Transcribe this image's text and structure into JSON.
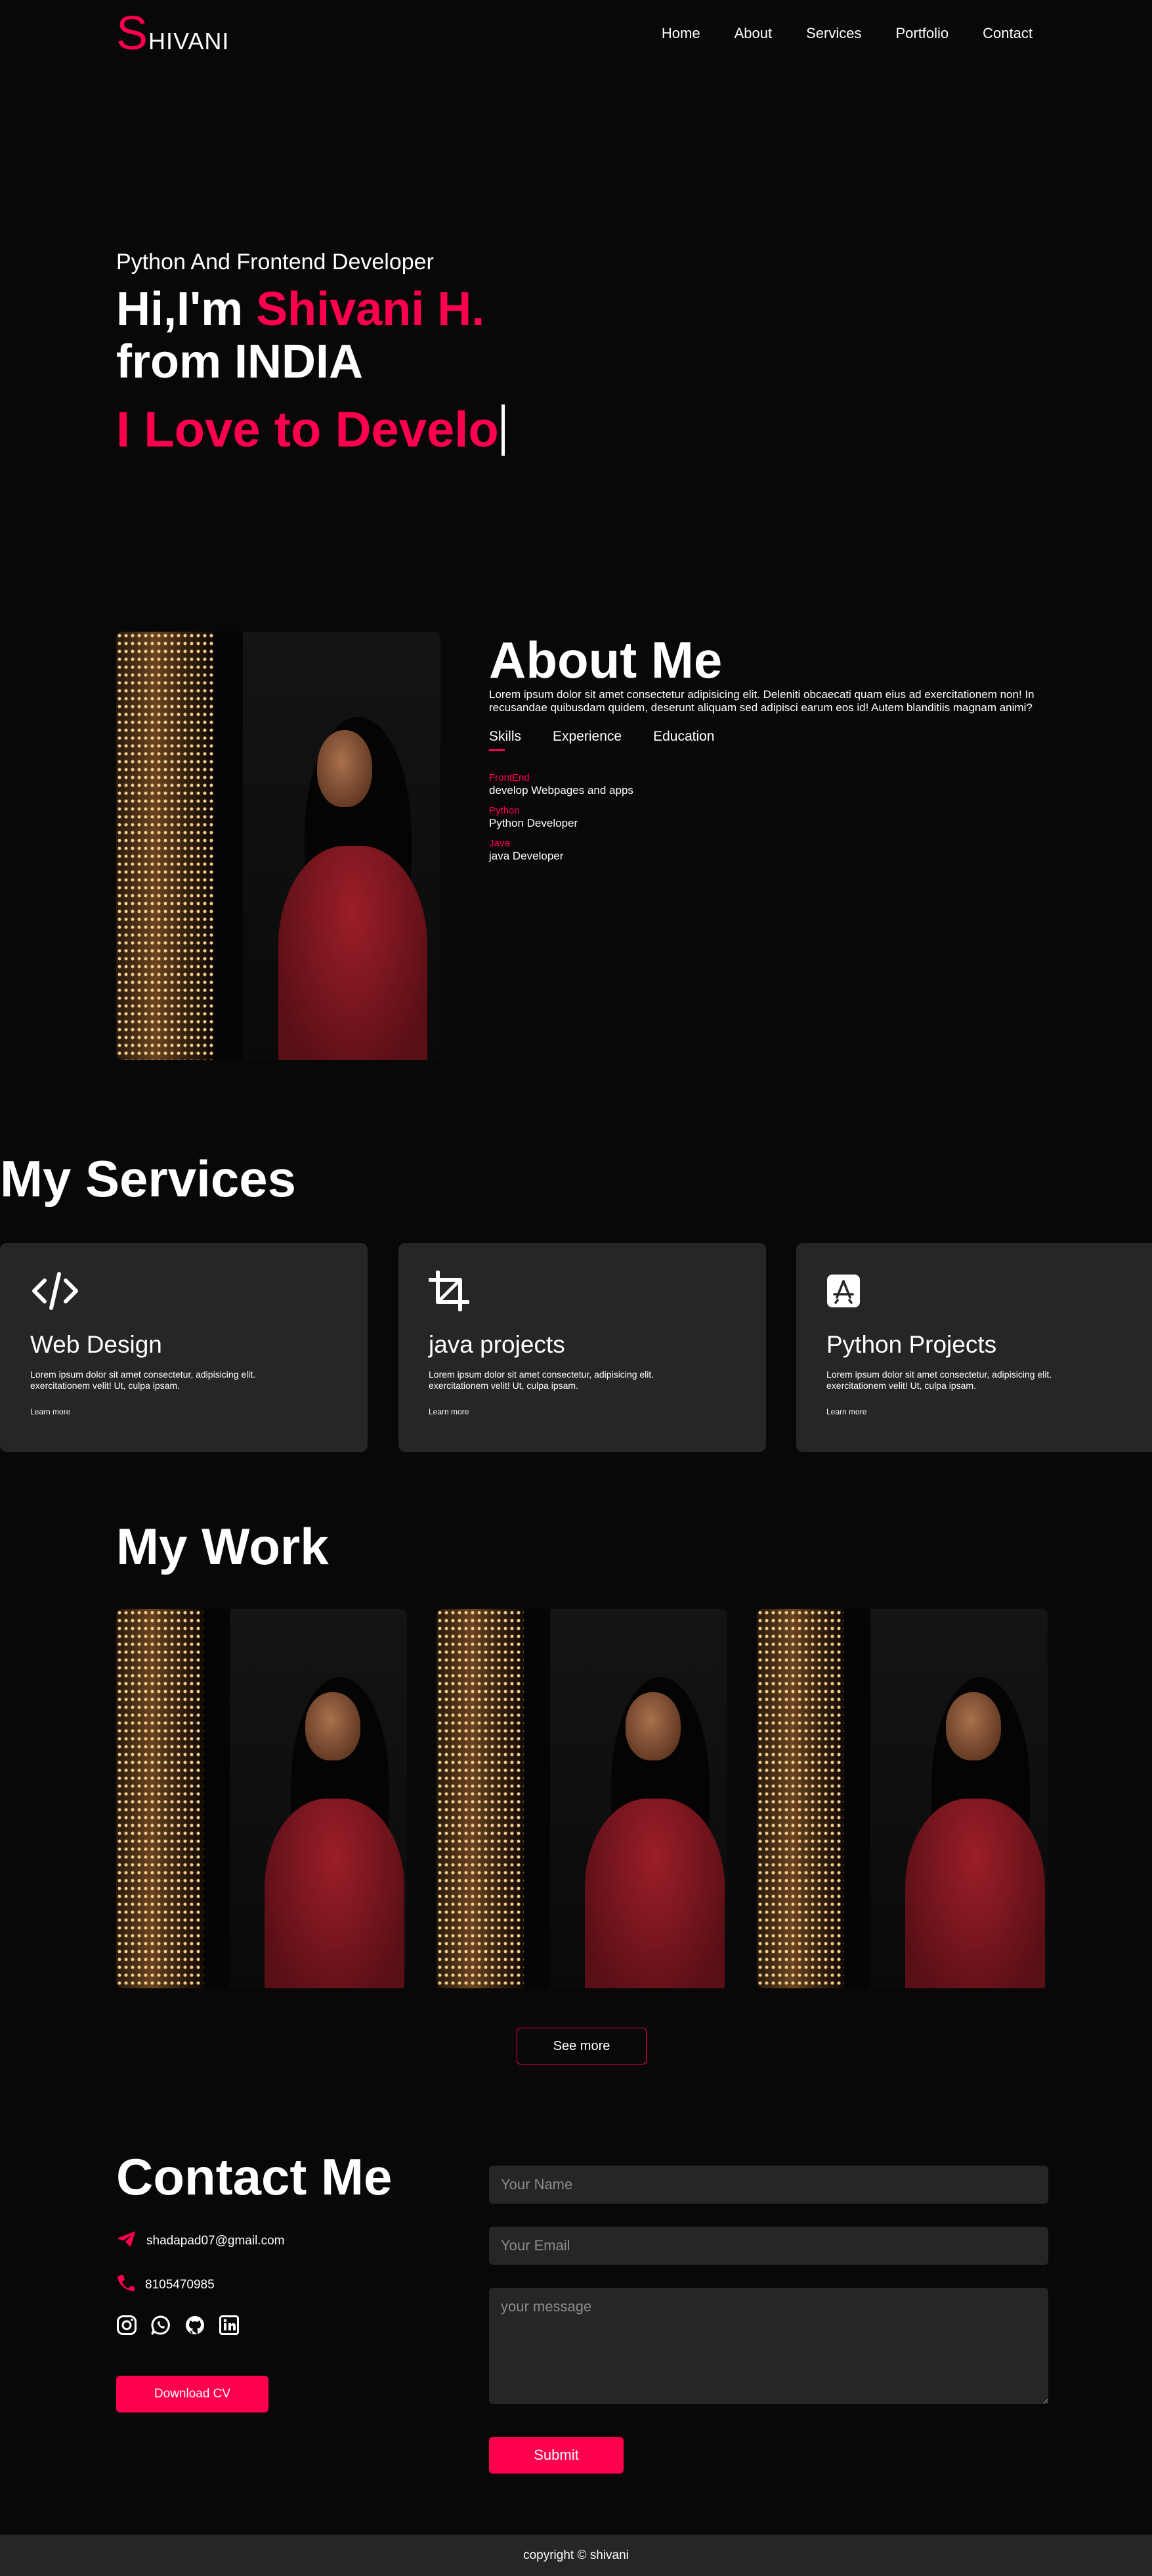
{
  "nav": {
    "logo_initial": "S",
    "logo_rest": "HIVANI",
    "links": [
      "Home",
      "About",
      "Services",
      "Portfolio",
      "Contact"
    ]
  },
  "hero": {
    "subtitle": "Python And Frontend Developer",
    "greeting": "Hi,I'm ",
    "name": "Shivani H.",
    "from": "from INDIA",
    "typing": "I Love to Develo"
  },
  "about": {
    "title": "About Me",
    "text": "Lorem ipsum dolor sit amet consectetur adipisicing elit. Deleniti obcaecati quam eius ad exercitationem non! In recusandae quibusdam quidem, deserunt aliquam sed adipisci earum eos id! Autem blanditiis magnam animi?",
    "tabs": [
      "Skills",
      "Experience",
      "Education"
    ],
    "skills": [
      {
        "key": "FrontEnd",
        "value": "develop Webpages and apps"
      },
      {
        "key": "Python",
        "value": "Python Developer"
      },
      {
        "key": "Java",
        "value": "java Developer"
      }
    ]
  },
  "services": {
    "title": "My Services",
    "items": [
      {
        "icon": "code-icon",
        "title": "Web Design",
        "text": "Lorem ipsum dolor sit amet consectetur, adipisicing elit. exercitationem velit! Ut, culpa ipsam.",
        "link": "Learn more"
      },
      {
        "icon": "crop-icon",
        "title": "java projects",
        "text": "Lorem ipsum dolor sit amet consectetur, adipisicing elit. exercitationem velit! Ut, culpa ipsam.",
        "link": "Learn more"
      },
      {
        "icon": "app-store-icon",
        "title": "Python Projects",
        "text": "Lorem ipsum dolor sit amet consectetur, adipisicing elit. exercitationem velit! Ut, culpa ipsam.",
        "link": "Learn more"
      }
    ]
  },
  "work": {
    "title": "My Work",
    "see_more": "See more"
  },
  "contact": {
    "title": "Contact Me",
    "email": "shadapad07@gmail.com",
    "phone": "8105470985",
    "socials": [
      "instagram-icon",
      "whatsapp-icon",
      "github-icon",
      "linkedin-icon"
    ],
    "download": "Download CV",
    "name_placeholder": "Your Name",
    "email_placeholder": "Your Email",
    "message_placeholder": "your message",
    "submit": "Submit"
  },
  "footer": {
    "text": "copyright © shivani"
  },
  "colors": {
    "accent": "#ff004f",
    "background": "#080808",
    "card": "#262626"
  }
}
